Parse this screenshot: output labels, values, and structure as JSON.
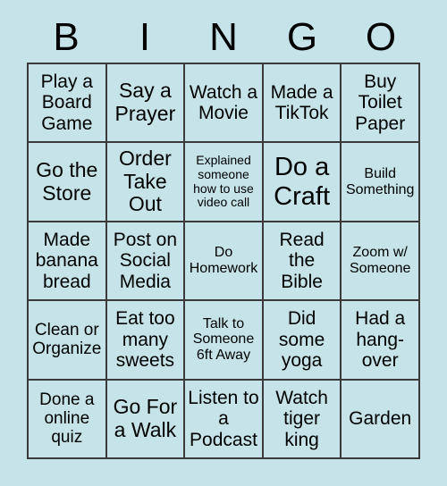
{
  "card": {
    "background_color": "#c5e3e8",
    "border_color": "#3a3a3a",
    "text_color": "#000000",
    "header": {
      "letters": [
        "B",
        "I",
        "N",
        "G",
        "O"
      ]
    },
    "grid": {
      "columns": 5,
      "rows": 5,
      "cells": [
        {
          "text": "Play a Board Game",
          "size": "l"
        },
        {
          "text": "Say a Prayer",
          "size": "xl"
        },
        {
          "text": "Watch a Movie",
          "size": "l"
        },
        {
          "text": "Made a TikTok",
          "size": "l"
        },
        {
          "text": "Buy Toilet Paper",
          "size": "l"
        },
        {
          "text": "Go the Store",
          "size": "xl"
        },
        {
          "text": "Order Take Out",
          "size": "xl"
        },
        {
          "text": "Explained someone how to use video call",
          "size": "xs"
        },
        {
          "text": "Do a Craft",
          "size": "xxl"
        },
        {
          "text": "Build Something",
          "size": "s"
        },
        {
          "text": "Made banana bread",
          "size": "l"
        },
        {
          "text": "Post on Social Media",
          "size": "l"
        },
        {
          "text": "Do Homework",
          "size": "s"
        },
        {
          "text": "Read the Bible",
          "size": "l"
        },
        {
          "text": "Zoom w/ Someone",
          "size": "s"
        },
        {
          "text": "Clean or Organize",
          "size": "m"
        },
        {
          "text": "Eat too many sweets",
          "size": "l"
        },
        {
          "text": "Talk to Someone 6ft Away",
          "size": "s"
        },
        {
          "text": "Did some yoga",
          "size": "l"
        },
        {
          "text": "Had a hang-over",
          "size": "l"
        },
        {
          "text": "Done a online quiz",
          "size": "m"
        },
        {
          "text": "Go For a Walk",
          "size": "xl"
        },
        {
          "text": "Listen to a Podcast",
          "size": "l"
        },
        {
          "text": "Watch tiger king",
          "size": "l"
        },
        {
          "text": "Garden",
          "size": "l"
        }
      ]
    }
  }
}
